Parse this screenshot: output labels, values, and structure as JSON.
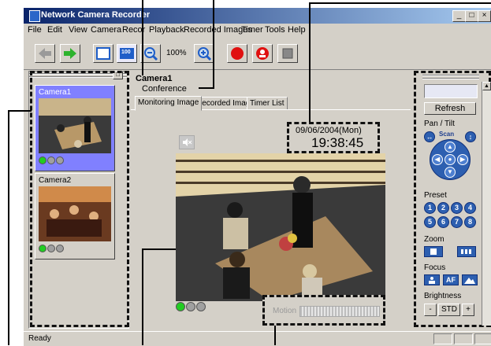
{
  "window": {
    "title": "Network Camera Recorder",
    "minimize_glyph": "_",
    "maximize_glyph": "□",
    "close_glyph": "×"
  },
  "menu": [
    "File",
    "Edit",
    "View",
    "Camera",
    "Recor",
    "Playback",
    "Recorded Images",
    "Timer",
    "Tools",
    "Help"
  ],
  "toolbar": {
    "zoom_level": "100%",
    "icons": [
      "back-arrow-icon",
      "forward-arrow-icon",
      "fullscreen-icon",
      "size-100-icon",
      "zoom-out-icon",
      "zoom-in-icon",
      "record-icon",
      "emergency-icon",
      "stop-icon"
    ],
    "size_button_text": "100"
  },
  "cameras": [
    {
      "name": "Camera1",
      "selected": true,
      "status": [
        "green",
        "gray",
        "gray"
      ]
    },
    {
      "name": "Camera2",
      "selected": false,
      "status": [
        "green",
        "gray",
        "gray"
      ]
    }
  ],
  "main": {
    "camera_name": "Camera1",
    "camera_location": "Conference",
    "tabs": [
      "Monitoring Image",
      "Recorded Image",
      "Timer List"
    ],
    "date": "09/06/2004(Mon)",
    "time": "19:38:45",
    "motion_label": "Motion",
    "status_leds": [
      "green",
      "gray",
      "gray"
    ]
  },
  "controls": {
    "refresh": "Refresh",
    "pan_tilt": "Pan / Tilt",
    "scan": "Scan",
    "preset": "Preset",
    "presets": [
      "1",
      "2",
      "3",
      "4",
      "5",
      "6",
      "7",
      "8"
    ],
    "zoom": "Zoom",
    "focus": "Focus",
    "af": "AF",
    "brightness": "Brightness",
    "brightness_minus": "-",
    "brightness_std": "STD",
    "brightness_plus": "+"
  },
  "statusbar": {
    "text": "Ready"
  },
  "colors": {
    "accent": "#2d5fb0",
    "selected_cam": "#8080ff",
    "led_green": "#22cc22",
    "led_gray": "#a0a0a0"
  }
}
